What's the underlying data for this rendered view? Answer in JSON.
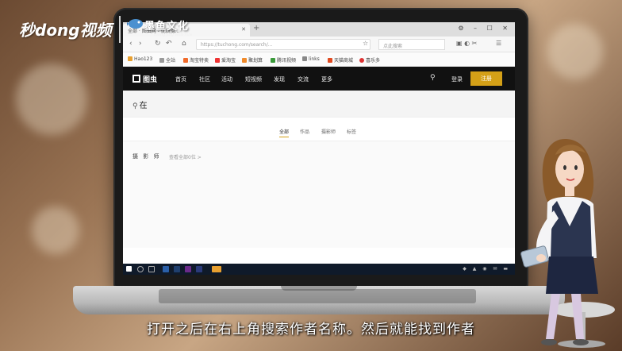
{
  "watermark": {
    "main": "秒dong视频",
    "brand": "墨鱼文化",
    "brand_sub": "mong jing wen hua"
  },
  "browser": {
    "tab_title": "全部 · 图虫网 - 优质摄...",
    "new_tab": "+",
    "window_controls": "⚙ – ☐ ✕",
    "address_text": "https://tuchong.com/search/...",
    "search_placeholder": "点此搜索",
    "bookmarks": [
      "Hao123",
      "全站",
      "淘宝特卖",
      "爱淘宝",
      "聚划算",
      "腾讯视频",
      "links",
      "天猫商城",
      "喜乐多"
    ]
  },
  "site": {
    "logo": "图虫",
    "menu": [
      "首页",
      "社区",
      "活动",
      "短视频",
      "发现",
      "交流",
      "更多"
    ],
    "login": "登录",
    "register": "注册",
    "search_query": "在",
    "filters": [
      "全部",
      "作品",
      "摄影师",
      "标签"
    ],
    "active_filter": "全部",
    "section_title": "摄 影 师",
    "section_link": "查看全部0位 >"
  },
  "subtitle": "打开之后在右上角搜索作者名称。然后就能找到作者",
  "colors": {
    "accent": "#d4a017",
    "site_header": "#111111",
    "taskbar": "#0f1a2a"
  }
}
